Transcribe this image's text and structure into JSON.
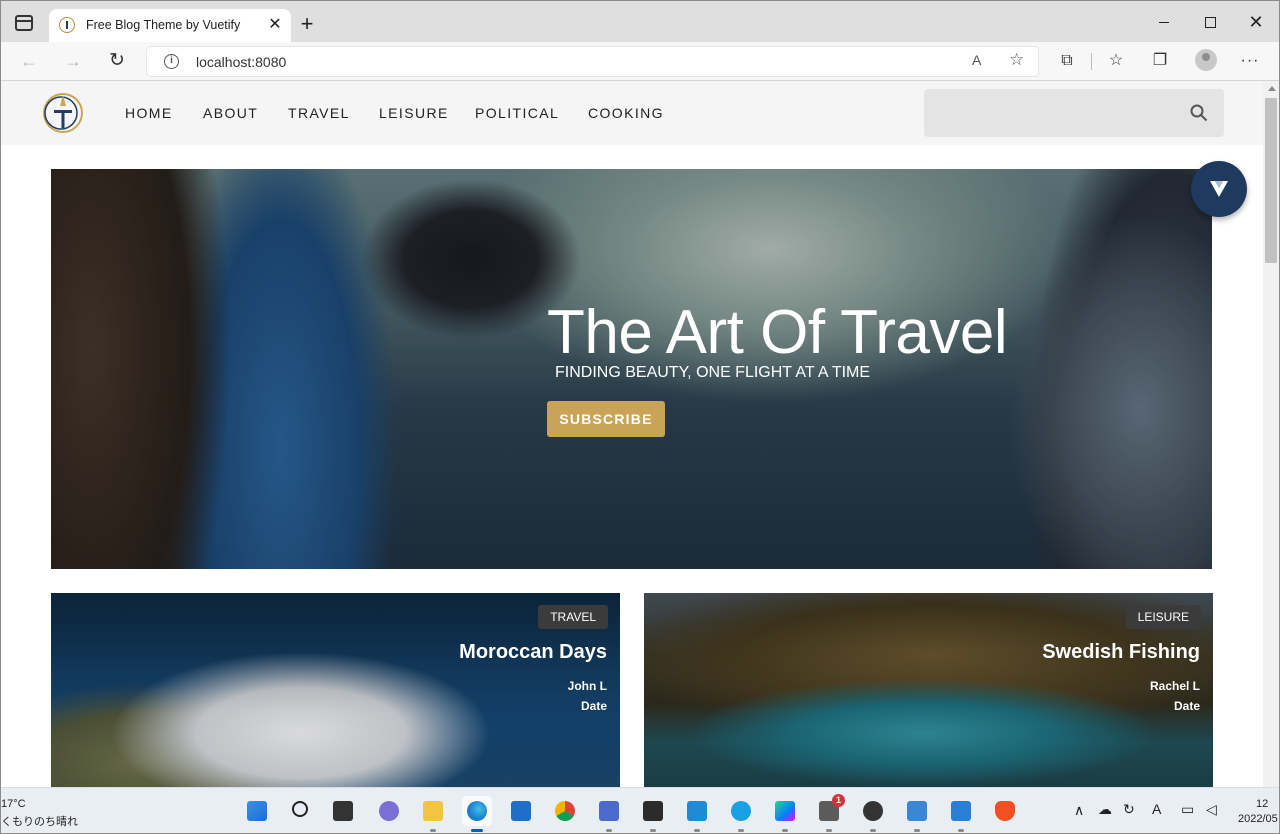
{
  "browser": {
    "tab_title": "Free Blog Theme by Vuetify",
    "tab_close": "✕",
    "new_tab": "+",
    "url": "localhost:8080",
    "read_aloud": "A",
    "favorite": "☆",
    "menu": "···"
  },
  "nav": {
    "links": [
      "HOME",
      "ABOUT",
      "TRAVEL",
      "LEISURE",
      "POLITICAL",
      "COOKING"
    ],
    "search_placeholder": ""
  },
  "hero": {
    "title": "The Art Of Travel",
    "subtitle": "FINDING BEAUTY, ONE FLIGHT AT A TIME",
    "button": "SUBSCRIBE"
  },
  "cards": [
    {
      "category": "TRAVEL",
      "title": "Moroccan Days",
      "author": "John L",
      "date": "Date"
    },
    {
      "category": "LEISURE",
      "title": "Swedish Fishing",
      "author": "Rachel L",
      "date": "Date"
    }
  ],
  "taskbar": {
    "temperature": "17°C",
    "condition": "くもりのち晴れ",
    "notification_count": "1",
    "clock_time": "12",
    "clock_date": "2022/05",
    "tray_font_label": "A"
  },
  "colors": {
    "accent": "#c9a456",
    "fab": "#1f3a5f",
    "chip": "#3b3b3b"
  },
  "icons": [
    "tab-actions-icon",
    "favicon-icon",
    "back-icon",
    "forward-icon",
    "reload-icon",
    "info-icon",
    "read-aloud-icon",
    "favorite-icon",
    "extensions-icon",
    "favorites-icon",
    "collections-icon",
    "profile-icon",
    "menu-icon",
    "search-icon",
    "vuetify-logo-icon"
  ]
}
